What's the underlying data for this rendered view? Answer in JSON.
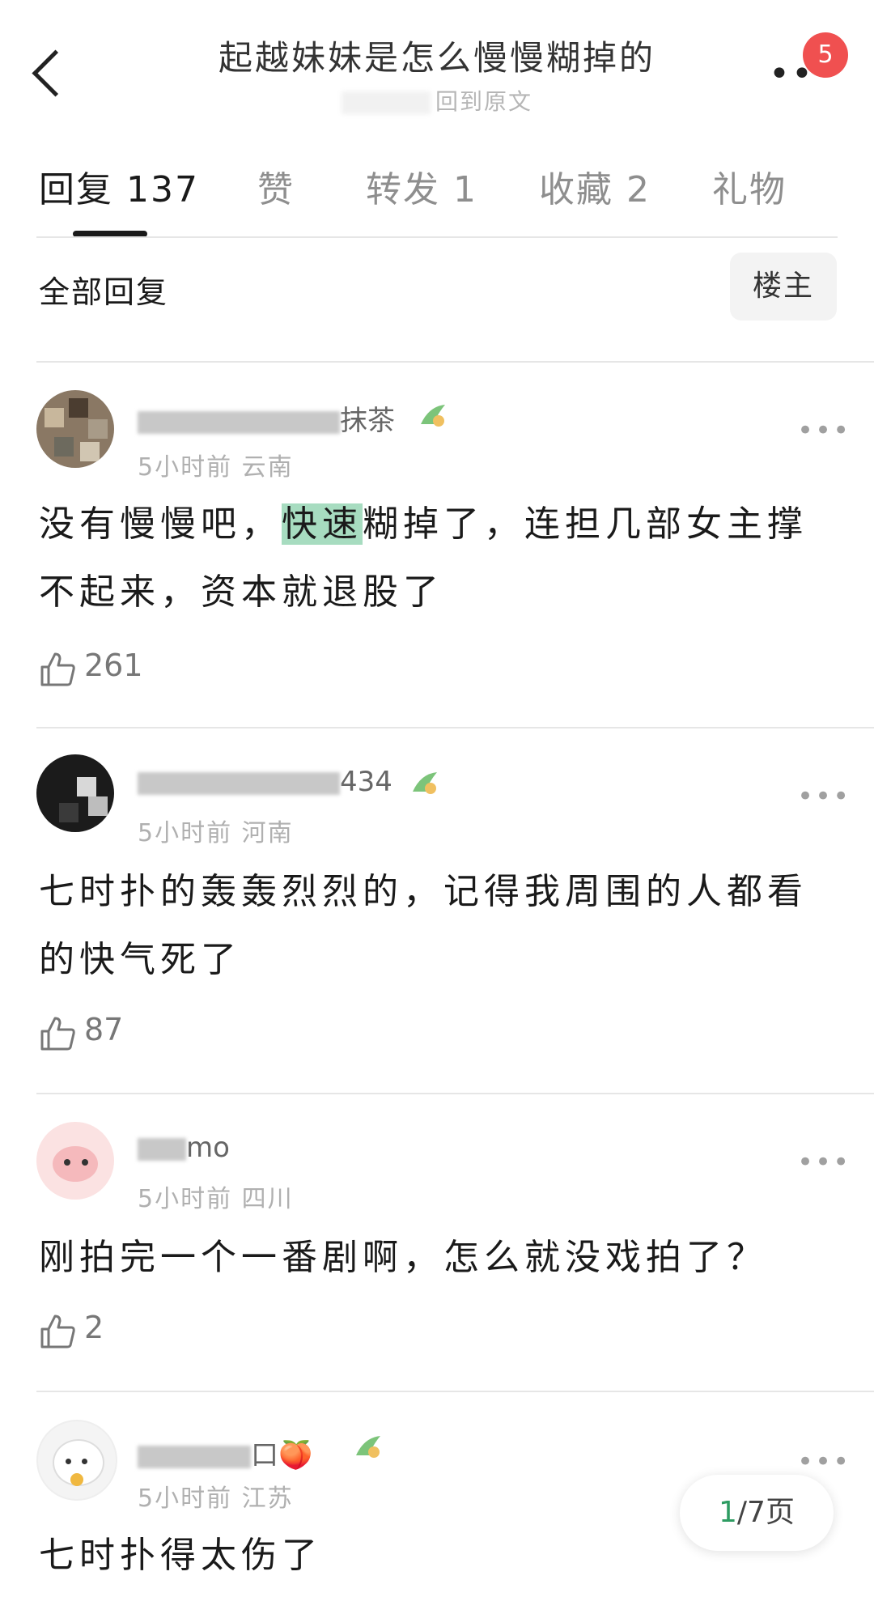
{
  "header": {
    "title": "起越妹妹是怎么慢慢糊掉的",
    "subtitle": "回到原文",
    "notification_count": "5",
    "more_label": "••"
  },
  "tabs": [
    {
      "label": "回复 137"
    },
    {
      "label": "赞"
    },
    {
      "label": "转发 1"
    },
    {
      "label": "收藏 2"
    },
    {
      "label": "礼物"
    }
  ],
  "filter": {
    "all_replies": "全部回复",
    "op_only": "楼主"
  },
  "comments": [
    {
      "username": "抹茶",
      "time": "5小时前",
      "location": "云南",
      "text_before": "没有慢慢吧，",
      "text_highlight": "快速",
      "text_after": "糊掉了，连担几部女主撑不起来，资本就退股了",
      "likes": "261"
    },
    {
      "username": "434",
      "time": "5小时前",
      "location": "河南",
      "text": "七时扑的轰轰烈烈的，记得我周围的人都看的快气死了",
      "likes": "87"
    },
    {
      "username": "mo",
      "time": "5小时前",
      "location": "四川",
      "text": "刚拍完一个一番剧啊，怎么就没戏拍了？",
      "likes": "2"
    },
    {
      "username": "口🍑",
      "time": "5小时前",
      "location": "江苏",
      "text": "七时扑得太伤了"
    }
  ],
  "pager": {
    "current": "1",
    "rest": "/7页"
  },
  "colors": {
    "highlight": "#a7dcc0",
    "badge": "#f05050",
    "pager_current": "#2e9c62"
  }
}
